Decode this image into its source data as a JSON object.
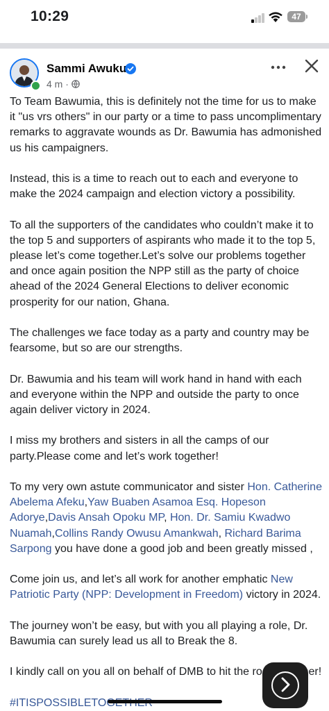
{
  "status_bar": {
    "time": "10:29",
    "battery": "47"
  },
  "post": {
    "author": "Sammi Awuku",
    "meta": "4 m ·",
    "paragraphs": [
      {
        "segments": [
          {
            "text": "To Team Bawumia, this is definitely not the time for us to make it \"us vrs others\" in our party or a time to pass uncomplimentary remarks to aggravate wounds as Dr. Bawumia has admonished us his campaigners."
          }
        ]
      },
      {
        "segments": [
          {
            "text": "Instead, this is a time to reach  out to each and everyone to make the 2024 campaign and election victory a possibility."
          }
        ]
      },
      {
        "segments": [
          {
            "text": "To all the supporters of the candidates who couldn’t make it to the top 5 and supporters of aspirants who made it to the top 5, please let’s come together.Let’s solve our problems together and once again position the NPP still as the party of choice ahead of the 2024 General Elections to deliver economic prosperity for our  nation, Ghana."
          }
        ]
      },
      {
        "segments": [
          {
            "text": "The challenges we face today as a party and country may be fearsome, but so are our strengths."
          }
        ]
      },
      {
        "segments": [
          {
            "text": "Dr. Bawumia and his team will work hand in hand with each and  everyone within the NPP and outside the party to once again deliver victory in 2024."
          }
        ]
      },
      {
        "segments": [
          {
            "text": "I miss my brothers and sisters in all the camps of our party.Please come and let’s work together!"
          }
        ]
      },
      {
        "segments": [
          {
            "text": "To my very own astute communicator and sister "
          },
          {
            "text": "Hon. Catherine Abelema Afeku",
            "link": true
          },
          {
            "text": ","
          },
          {
            "text": "Yaw Buaben Asamoa Esq. Hopeson Adorye",
            "link": true
          },
          {
            "text": ","
          },
          {
            "text": "Davis Ansah Opoku MP",
            "link": true
          },
          {
            "text": ", "
          },
          {
            "text": "Hon. Dr. Samiu Kwadwo Nuamah",
            "link": true
          },
          {
            "text": ","
          },
          {
            "text": "Collins Randy Owusu Amankwah",
            "link": true
          },
          {
            "text": ", "
          },
          {
            "text": "Richard Barima Sarpong",
            "link": true
          },
          {
            "text": " you have done a good job and been greatly missed ,"
          }
        ]
      },
      {
        "segments": [
          {
            "text": "Come  join us, and let’s all work for another emphatic "
          },
          {
            "text": "New Patriotic Party (NPP: Development in Freedom)",
            "link": true
          },
          {
            "text": " victory in 2024."
          }
        ]
      },
      {
        "segments": [
          {
            "text": "The journey won’t be easy, but with you all playing a role, Dr. Bawumia can surely lead us all to Break the 8."
          }
        ]
      },
      {
        "segments": [
          {
            "text": "I kindly call on you all on behalf of DMB to hit the road together!"
          }
        ]
      }
    ],
    "hashtag": "#ITISPOSSIBLETOGETHER"
  },
  "icons": {
    "verified": "verified-badge-icon",
    "more": "more-options-icon",
    "close": "close-icon",
    "privacy": "globe-icon",
    "next": "chevron-right-icon"
  },
  "colors": {
    "link": "#385898",
    "verified": "#1877f2",
    "online": "#31a24c"
  }
}
